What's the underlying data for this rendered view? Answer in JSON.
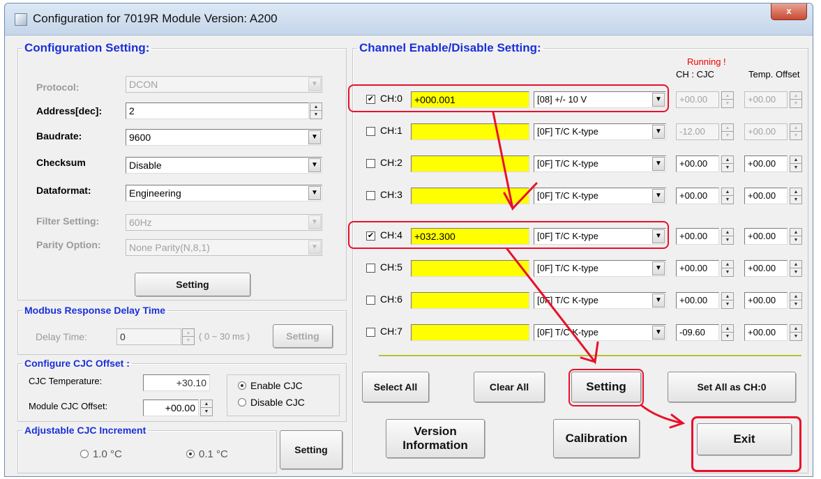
{
  "window": {
    "title": "Configuration for 7019R Module Version: A200",
    "close_label": "x"
  },
  "config": {
    "legend": "Configuration Setting:",
    "protocol": {
      "label": "Protocol:",
      "value": "DCON"
    },
    "address": {
      "label": "Address[dec]:",
      "value": "2"
    },
    "baudrate": {
      "label": "Baudrate:",
      "value": "9600"
    },
    "checksum": {
      "label": "Checksum",
      "value": "Disable"
    },
    "dataformat": {
      "label": "Dataformat:",
      "value": "Engineering"
    },
    "filter": {
      "label": "Filter Setting:",
      "value": "60Hz"
    },
    "parity": {
      "label": "Parity Option:",
      "value": "None Parity(N,8,1)"
    },
    "setting_label": "Setting"
  },
  "modbus": {
    "legend": "Modbus Response Delay Time",
    "delay_label": "Delay Time:",
    "delay_value": "0",
    "range_text": "( 0 ~ 30 ms )",
    "setting_label": "Setting"
  },
  "cjc": {
    "legend": "Configure CJC Offset :",
    "temp_label": "CJC Temperature:",
    "temp_value": "+30.10",
    "offset_label": "Module CJC Offset:",
    "offset_value": "+00.00",
    "enable_label": "Enable CJC",
    "disable_label": "Disable CJC",
    "enabled": true
  },
  "increment": {
    "legend": "Adjustable CJC Increment",
    "opt1_label": "1.0 °C",
    "opt2_label": "0.1 °C",
    "selected": "0.1",
    "setting_label": "Setting"
  },
  "channels": {
    "legend": "Channel Enable/Disable Setting:",
    "running": "Running !",
    "col_cjc": "CH : CJC",
    "col_offset": "Temp. Offset",
    "rows": [
      {
        "label": "CH:0",
        "checked": true,
        "value": "+000.001",
        "range": "[08] +/- 10 V",
        "cjc": "+00.00",
        "offset": "+00.00",
        "cjc_enabled": false
      },
      {
        "label": "CH:1",
        "checked": false,
        "value": "",
        "range": "[0F] T/C K-type",
        "cjc": "-12.00",
        "offset": "+00.00",
        "cjc_enabled": false
      },
      {
        "label": "CH:2",
        "checked": false,
        "value": "",
        "range": "[0F] T/C K-type",
        "cjc": "+00.00",
        "offset": "+00.00",
        "cjc_enabled": true
      },
      {
        "label": "CH:3",
        "checked": false,
        "value": "",
        "range": "[0F] T/C K-type",
        "cjc": "+00.00",
        "offset": "+00.00",
        "cjc_enabled": true
      },
      {
        "label": "CH:4",
        "checked": true,
        "value": "+032.300",
        "range": "[0F] T/C K-type",
        "cjc": "+00.00",
        "offset": "+00.00",
        "cjc_enabled": true
      },
      {
        "label": "CH:5",
        "checked": false,
        "value": "",
        "range": "[0F] T/C K-type",
        "cjc": "+00.00",
        "offset": "+00.00",
        "cjc_enabled": true
      },
      {
        "label": "CH:6",
        "checked": false,
        "value": "",
        "range": "[0F] T/C K-type",
        "cjc": "+00.00",
        "offset": "+00.00",
        "cjc_enabled": true
      },
      {
        "label": "CH:7",
        "checked": false,
        "value": "",
        "range": "[0F] T/C K-type",
        "cjc": "-09.60",
        "offset": "+00.00",
        "cjc_enabled": true
      }
    ],
    "select_all_label": "Select All",
    "clear_all_label": "Clear All",
    "setting_label": "Setting",
    "set_all_label": "Set All as CH:0"
  },
  "bottom": {
    "version_label_1": "Version",
    "version_label_2": "Information",
    "calibration_label": "Calibration",
    "exit_label": "Exit"
  },
  "annotation_color": "#e8102a"
}
